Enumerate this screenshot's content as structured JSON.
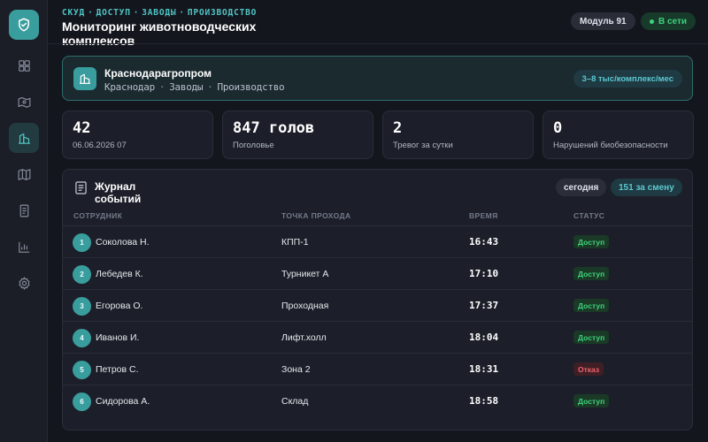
{
  "header": {
    "breadcrumbs": [
      "СКУД",
      "ДОСТУП",
      "ЗАВОДЫ",
      "ПРОИЗВОДСТВО"
    ],
    "title": "Мониторинг животноводческих комплексов",
    "module_label": "Модуль 91",
    "status_label": "В сети"
  },
  "sidebar": {
    "items": [
      {
        "icon": "dashboard-icon"
      },
      {
        "icon": "map-route-icon"
      },
      {
        "icon": "building-icon",
        "active": true
      },
      {
        "icon": "map-icon"
      },
      {
        "icon": "document-icon"
      },
      {
        "icon": "bar-chart-icon"
      },
      {
        "icon": "gear-icon"
      }
    ]
  },
  "company": {
    "name": "Краснодарагропром",
    "path": [
      "Краснодар",
      "Заводы",
      "Производство"
    ],
    "rate": "3–8 тыс/комплекс/мес"
  },
  "stats": [
    {
      "value": "42",
      "label": "06.06.2026 07"
    },
    {
      "value": "847 голов",
      "label": "Поголовье"
    },
    {
      "value": "2",
      "label": "Тревог за сутки"
    },
    {
      "value": "0",
      "label": "Нарушений биобезопасности"
    }
  ],
  "journal": {
    "title": "Журнал событий",
    "today_label": "сегодня",
    "shift_label": "151 за смену",
    "columns": [
      "СОТРУДНИК",
      "ТОЧКА ПРОХОДА",
      "ВРЕМЯ",
      "СТАТУС"
    ],
    "rows": [
      {
        "num": "1",
        "name": "Соколова Н.",
        "point": "КПП-1",
        "time": "16:43",
        "status": "Доступ",
        "ok": true
      },
      {
        "num": "2",
        "name": "Лебедев К.",
        "point": "Турникет А",
        "time": "17:10",
        "status": "Доступ",
        "ok": true
      },
      {
        "num": "3",
        "name": "Егорова О.",
        "point": "Проходная",
        "time": "17:37",
        "status": "Доступ",
        "ok": true
      },
      {
        "num": "4",
        "name": "Иванов И.",
        "point": "Лифт.холл",
        "time": "18:04",
        "status": "Доступ",
        "ok": true
      },
      {
        "num": "5",
        "name": "Петров С.",
        "point": "Зона 2",
        "time": "18:31",
        "status": "Отказ",
        "ok": false
      },
      {
        "num": "6",
        "name": "Сидорова А.",
        "point": "Склад",
        "time": "18:58",
        "status": "Доступ",
        "ok": true
      }
    ]
  },
  "colors": {
    "accent": "#3a9d9d",
    "access_ok": "#3ed17a",
    "access_denied": "#f0606a",
    "background": "#14161d"
  }
}
